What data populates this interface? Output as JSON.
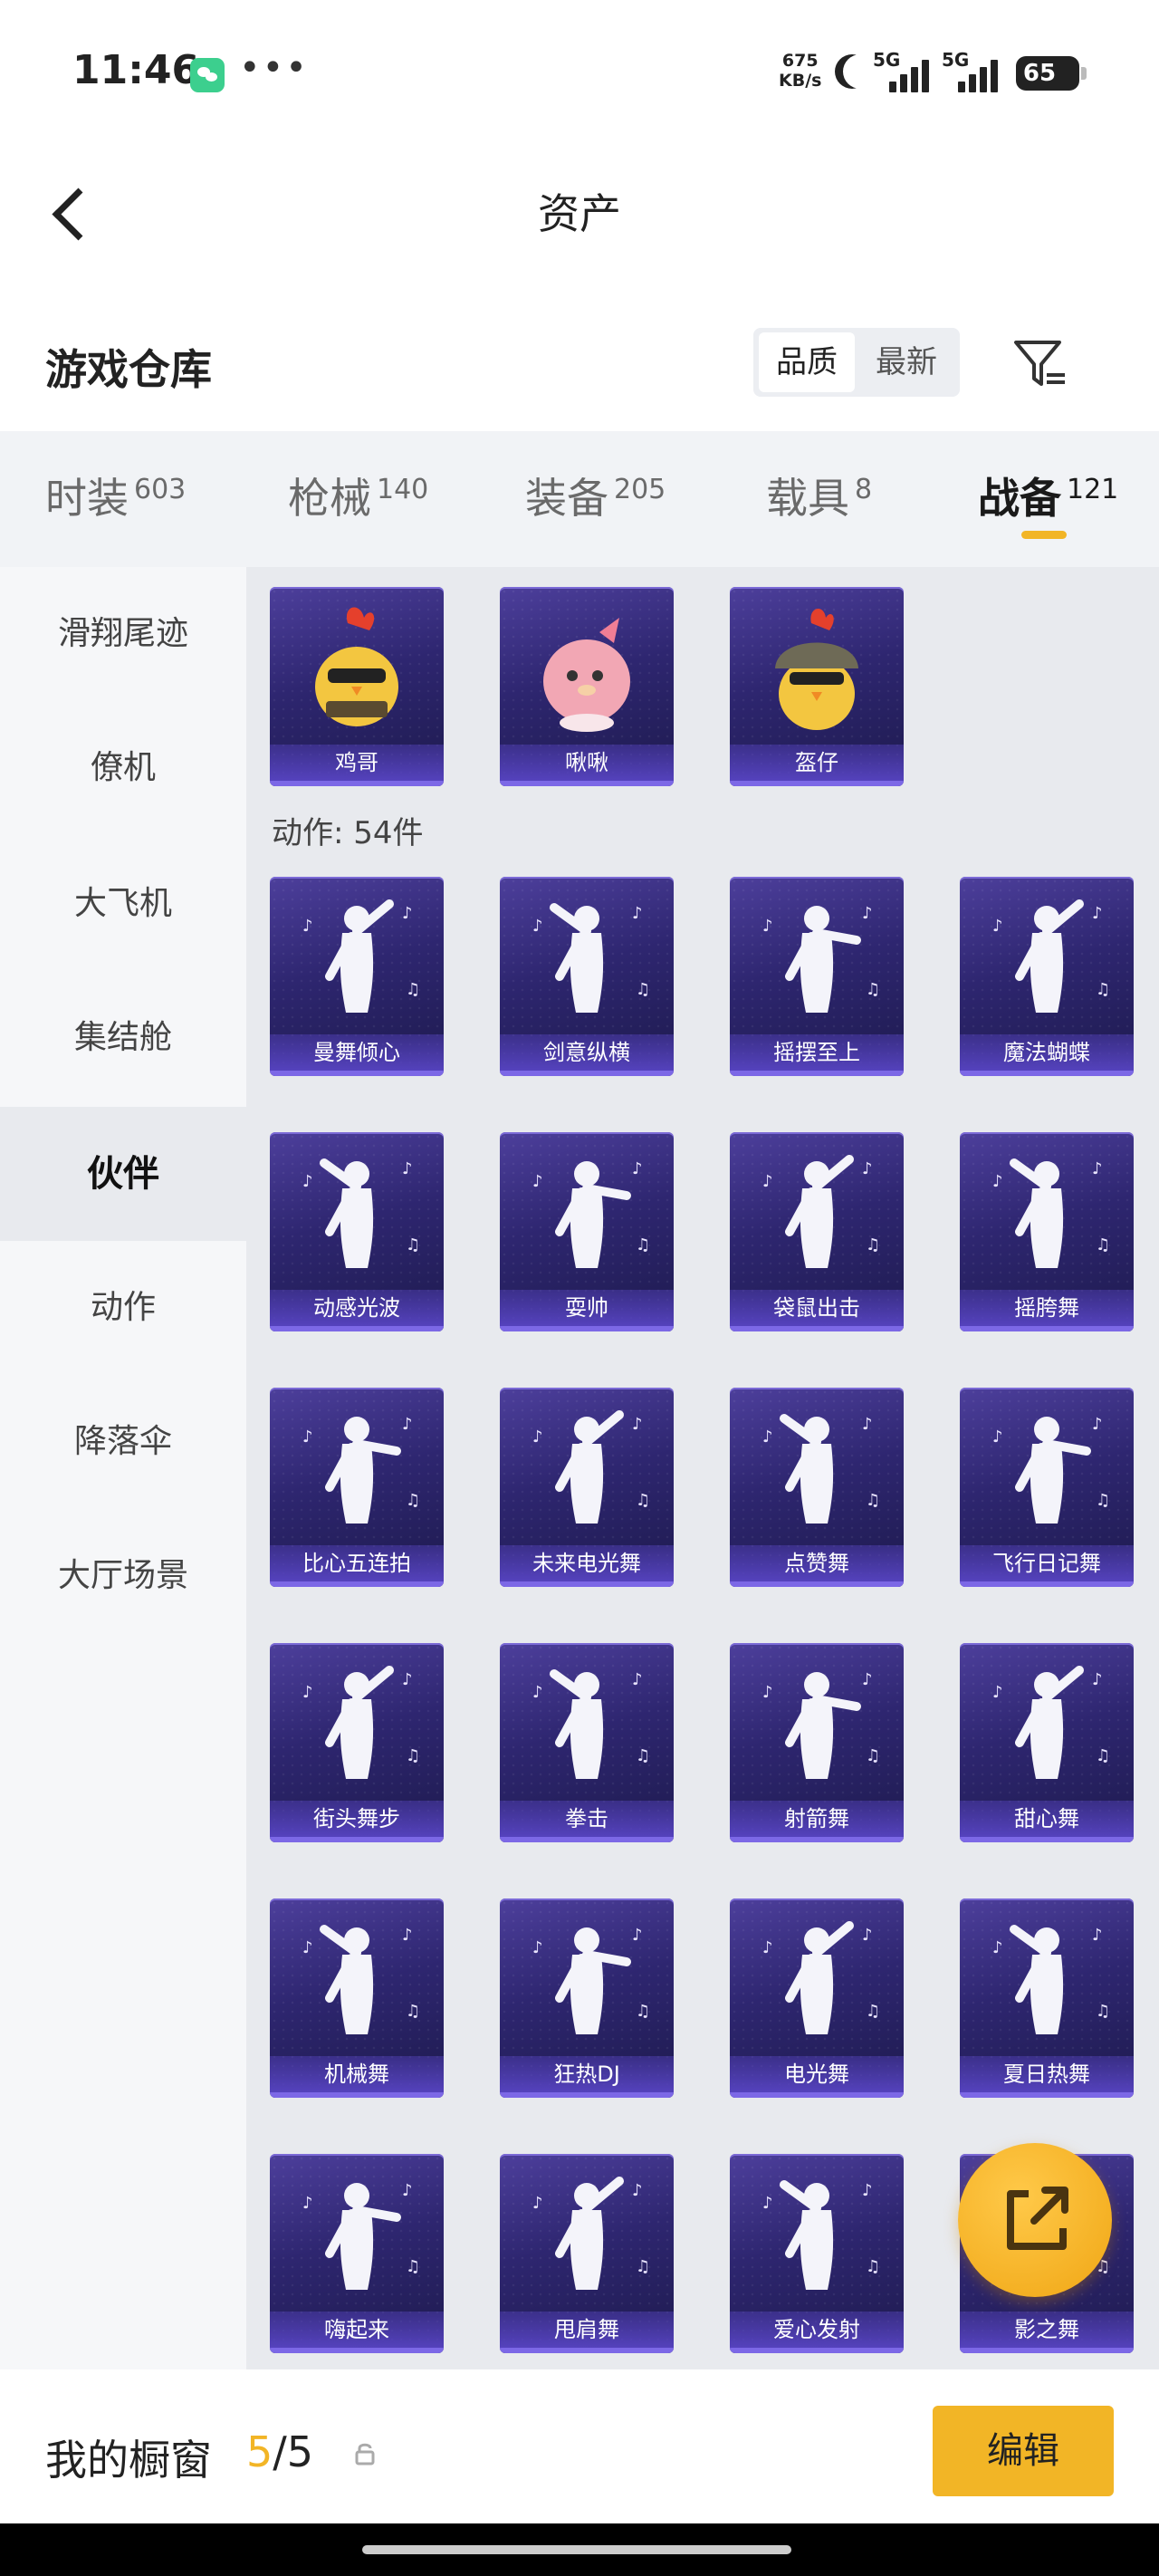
{
  "status_bar": {
    "time": "11:46",
    "net_speed_value": "675",
    "net_speed_unit": "KB/s",
    "signal_1_label": "5G",
    "signal_2_label": "5G",
    "battery": "65"
  },
  "header": {
    "title": "资产"
  },
  "section": {
    "title": "游戏仓库",
    "sort_options": [
      "品质",
      "最新"
    ],
    "sort_selected": "品质"
  },
  "tabs": [
    {
      "label": "时装",
      "count": "603"
    },
    {
      "label": "枪械",
      "count": "140"
    },
    {
      "label": "装备",
      "count": "205"
    },
    {
      "label": "载具",
      "count": "8"
    },
    {
      "label": "战备",
      "count": "121",
      "active": true
    }
  ],
  "sidebar": {
    "items": [
      "滑翔尾迹",
      "僚机",
      "大飞机",
      "集结舱",
      "伙伴",
      "动作",
      "降落伞",
      "大厅场景"
    ],
    "active": "伙伴"
  },
  "partners": {
    "items": [
      "鸡哥",
      "啾啾",
      "盔仔"
    ]
  },
  "actions": {
    "header": "动作: 54件",
    "items": [
      "曼舞倾心",
      "剑意纵横",
      "摇摆至上",
      "魔法蝴蝶",
      "动感光波",
      "耍帅",
      "袋鼠出击",
      "摇胯舞",
      "比心五连拍",
      "未来电光舞",
      "点赞舞",
      "飞行日记舞",
      "街头舞步",
      "拳击",
      "射箭舞",
      "甜心舞",
      "机械舞",
      "狂热DJ",
      "电光舞",
      "夏日热舞",
      "嗨起来",
      "甩肩舞",
      "爱心发射",
      "影之舞"
    ]
  },
  "showcase": {
    "label": "我的橱窗",
    "current": "5",
    "total": "/5",
    "edit_label": "编辑"
  },
  "colors": {
    "accent": "#f2b526",
    "card_bg": "#2e2670",
    "card_label": "#7c68e6"
  }
}
